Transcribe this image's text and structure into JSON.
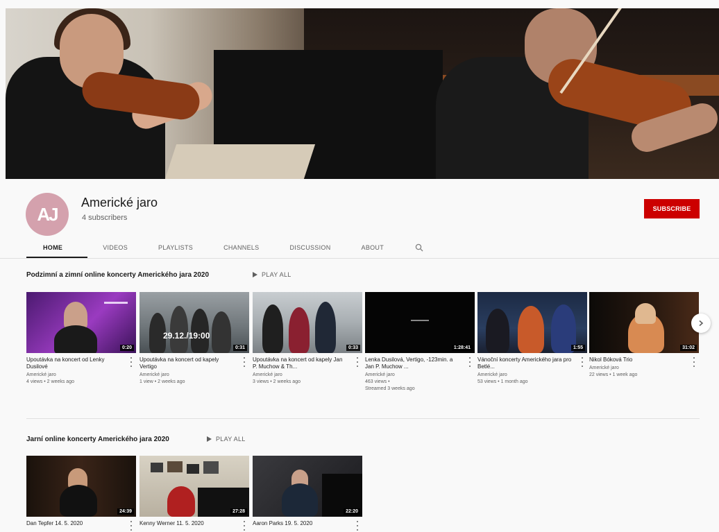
{
  "channel": {
    "name": "Americké jaro",
    "subscribers": "4 subscribers",
    "avatar_text": "AJ",
    "subscribe_label": "SUBSCRIBE"
  },
  "tabs": [
    "HOME",
    "VIDEOS",
    "PLAYLISTS",
    "CHANNELS",
    "DISCUSSION",
    "ABOUT"
  ],
  "shelves": [
    {
      "title": "Podzimní a zimní online koncerty Amerického jara 2020",
      "play_all": "PLAY ALL",
      "videos": [
        {
          "title": "Upoutávka na koncert od Lenky Dusilové",
          "channel": "Americké jaro",
          "stats": "4 views • 2 weeks ago",
          "extra": "",
          "duration": "0:20"
        },
        {
          "title": "Upoutávka na koncert od kapely Vertigo",
          "channel": "Americké jaro",
          "stats": "1 view • 2 weeks ago",
          "extra": "",
          "duration": "0:31"
        },
        {
          "title": "Upoutávka na koncert od kapely Jan P. Muchow & Th...",
          "channel": "Americké jaro",
          "stats": "3 views • 2 weeks ago",
          "extra": "",
          "duration": "0:33"
        },
        {
          "title": "Lenka Dusilová, Vertigo, -123min. a Jan P. Muchow ...",
          "channel": "Americké jaro",
          "stats": "463 views •",
          "extra": "Streamed 3 weeks ago",
          "duration": "1:28:41"
        },
        {
          "title": "Vánoční koncerty Amerického jara pro Betlé...",
          "channel": "Americké jaro",
          "stats": "53 views • 1 month ago",
          "extra": "",
          "duration": "1:55"
        },
        {
          "title": "Nikol Bóková Trio",
          "channel": "Americké jaro",
          "stats": "22 views • 1 week ago",
          "extra": "",
          "duration": "31:02"
        }
      ]
    },
    {
      "title": "Jarní online koncerty Amerického jara 2020",
      "play_all": "PLAY ALL",
      "videos": [
        {
          "title": "Dan Tepfer 14. 5. 2020",
          "channel": "",
          "stats": "",
          "extra": "",
          "duration": "24:39"
        },
        {
          "title": "Kenny Werner 11. 5. 2020",
          "channel": "",
          "stats": "",
          "extra": "",
          "duration": "27:28"
        },
        {
          "title": "Aaron Parks 19. 5. 2020",
          "channel": "",
          "stats": "",
          "extra": "",
          "duration": "22:20"
        }
      ]
    }
  ],
  "thumb_overlay_text": "29.12./19:00"
}
